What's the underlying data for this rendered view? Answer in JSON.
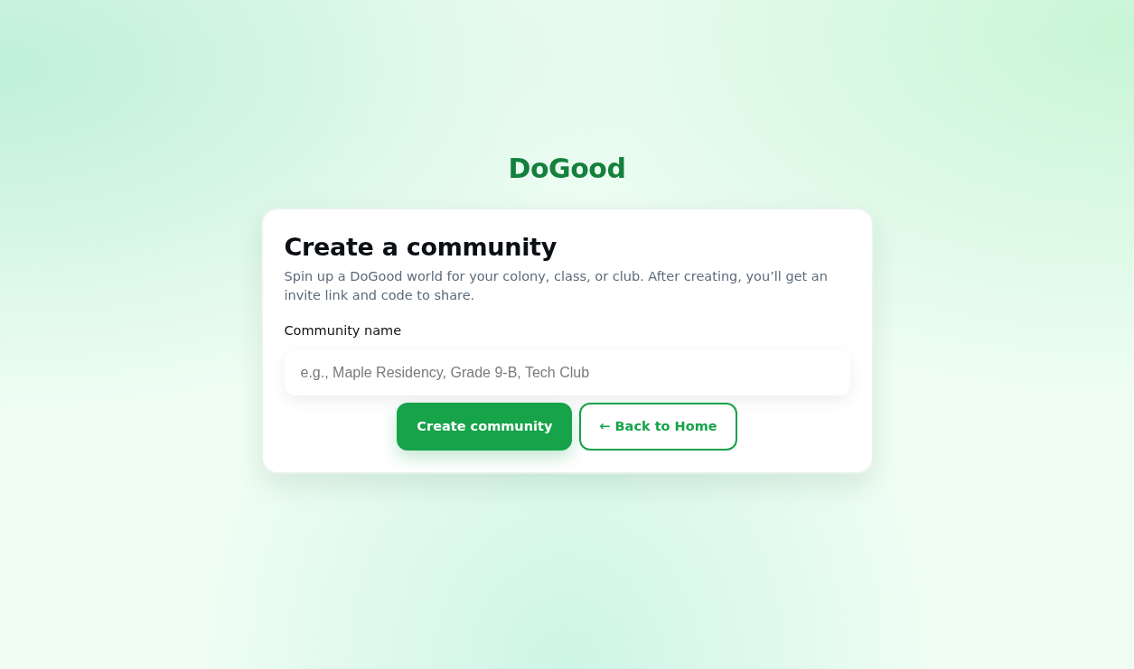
{
  "brand": "DoGood",
  "card": {
    "title": "Create a community",
    "description": "Spin up a DoGood world for your colony, class, or club. After creating, you’ll get an invite link and code to share.",
    "field": {
      "label": "Community name",
      "placeholder": "e.g., Maple Residency, Grade 9-B, Tech Club"
    },
    "buttons": [
      {
        "label": "Create community",
        "kind": "primary"
      },
      {
        "label": "← Back to Home",
        "kind": "outline"
      }
    ]
  }
}
